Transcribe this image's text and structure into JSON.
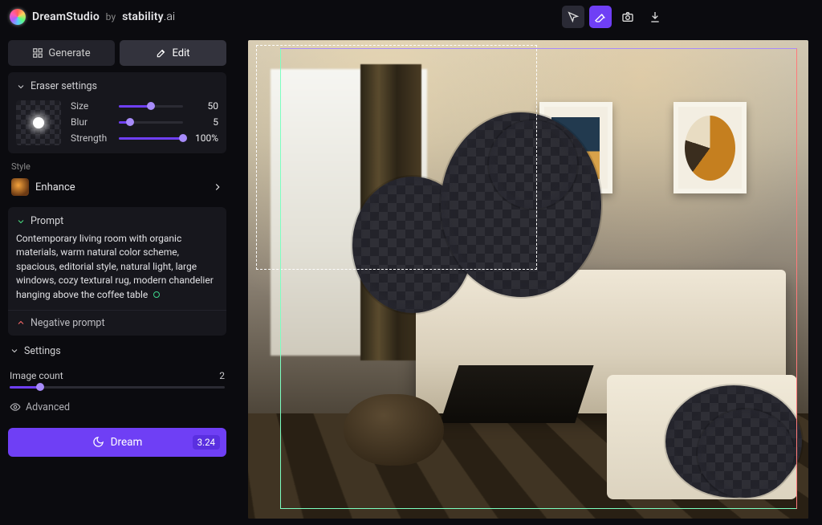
{
  "brand": {
    "app": "DreamStudio",
    "by": "by",
    "company_a": "stability",
    "company_b": ".ai"
  },
  "modes": {
    "generate": "Generate",
    "edit": "Edit"
  },
  "eraser": {
    "title": "Eraser settings",
    "size_label": "Size",
    "size_value": "50",
    "size_pct": 50,
    "blur_label": "Blur",
    "blur_value": "5",
    "blur_pct": 18,
    "strength_label": "Strength",
    "strength_value": "100%",
    "strength_pct": 100
  },
  "style": {
    "label": "Style",
    "name": "Enhance"
  },
  "prompt": {
    "title": "Prompt",
    "text": "Contemporary living room with organic materials, warm natural color scheme, spacious, editorial style, natural light, large windows, cozy textural rug, modern chandelier hanging above the coffee table"
  },
  "negative": {
    "title": "Negative prompt"
  },
  "settings": {
    "title": "Settings"
  },
  "image_count": {
    "label": "Image count",
    "value": "2",
    "pct": 14
  },
  "advanced": {
    "label": "Advanced"
  },
  "dream": {
    "label": "Dream",
    "cost": "3.24"
  }
}
